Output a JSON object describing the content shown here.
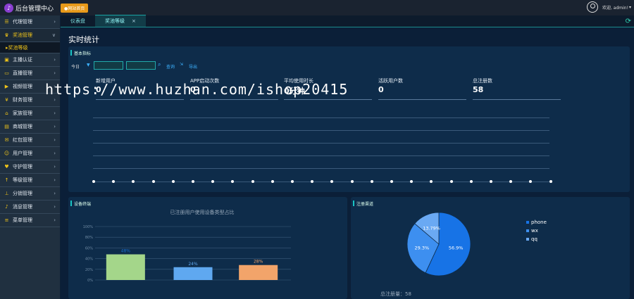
{
  "app": {
    "title": "后台管理中心",
    "site_button": "●网站首页",
    "user": "欢迎, admin!"
  },
  "sidebar": {
    "items": [
      {
        "label": "代理管理",
        "icon": "list-icon"
      },
      {
        "label": "奖池管理",
        "icon": "trophy-icon"
      },
      {
        "label": "主播认证",
        "icon": "id-card-icon"
      },
      {
        "label": "直播管理",
        "icon": "monitor-icon"
      },
      {
        "label": "视频管理",
        "icon": "video-icon"
      },
      {
        "label": "财务管理",
        "icon": "yen-icon"
      },
      {
        "label": "家族管理",
        "icon": "home-icon"
      },
      {
        "label": "商城管理",
        "icon": "cart-icon"
      },
      {
        "label": "红包管理",
        "icon": "envelope-icon"
      },
      {
        "label": "用户管理",
        "icon": "user-icon"
      },
      {
        "label": "守护管理",
        "icon": "heart-icon"
      },
      {
        "label": "等级管理",
        "icon": "arrow-up-icon"
      },
      {
        "label": "分销管理",
        "icon": "sitemap-icon"
      },
      {
        "label": "消息管理",
        "icon": "bell-icon"
      },
      {
        "label": "菜单管理",
        "icon": "menu-icon"
      }
    ],
    "sub_item": "奖池等级"
  },
  "tabs": [
    {
      "label": "仪表盘"
    },
    {
      "label": "奖池等级"
    }
  ],
  "page_title": "实时统计",
  "basic": {
    "title": "基本指标",
    "range": "今日",
    "query": "查询",
    "export": "导出",
    "stats": [
      {
        "label": "新增用户",
        "value": "0"
      },
      {
        "label": "APP启动次数",
        "value": "0"
      },
      {
        "label": "平均使用时长",
        "value": "0分钟"
      },
      {
        "label": "活跃用户数",
        "value": "0"
      },
      {
        "label": "总注册数",
        "value": "58"
      }
    ]
  },
  "watermark": "https://www.huzhan.com/ishop20415",
  "device_panel": {
    "title": "设备终端",
    "chart_title": "已注册用户使用设备类型占比"
  },
  "reg_panel": {
    "title": "注册渠道",
    "total": "总注册量：58"
  },
  "chart_data": [
    {
      "type": "bar",
      "title": "已注册用户使用设备类型占比",
      "categories": [
        "",
        "",
        ""
      ],
      "values": [
        48,
        24,
        28
      ],
      "value_labels": [
        "48%",
        "24%",
        "28%"
      ],
      "ylim": [
        0,
        100
      ],
      "yticks": [
        "0%",
        "20%",
        "40%",
        "60%",
        "80%",
        "100%"
      ],
      "colors": [
        "#a4d68a",
        "#5fa8f0",
        "#f2a46a"
      ]
    },
    {
      "type": "pie",
      "labels": [
        "phone",
        "wx",
        "qq"
      ],
      "values": [
        56.9,
        29.3,
        13.79
      ],
      "value_labels": [
        "56.9%",
        "29.3%",
        "13.79%"
      ],
      "colors": [
        "#1773e6",
        "#3d8ff0",
        "#6aa9f3"
      ]
    }
  ]
}
